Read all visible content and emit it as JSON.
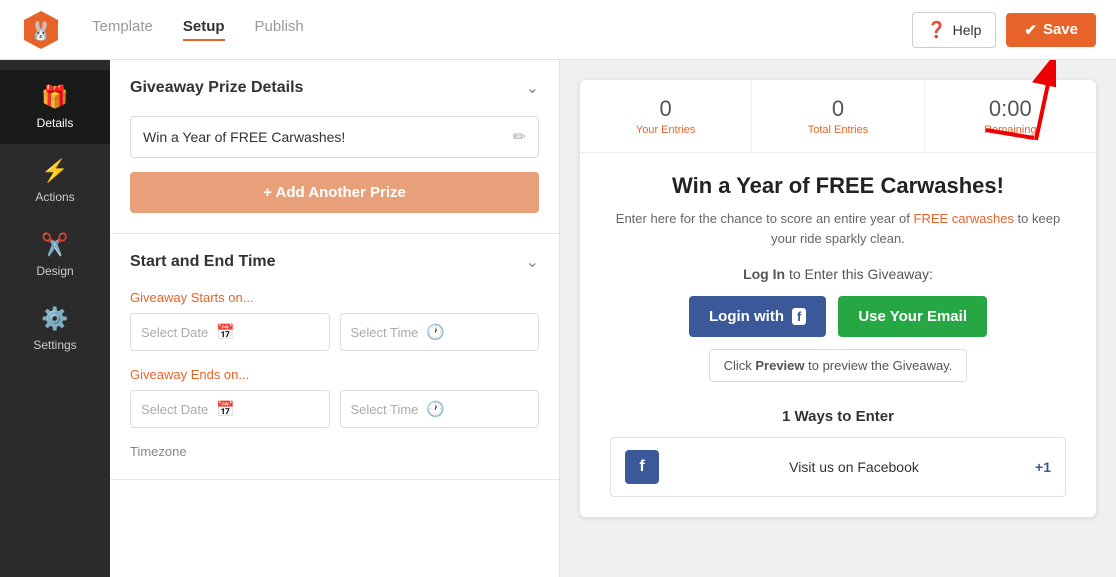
{
  "topNav": {
    "tabs": [
      {
        "label": "Template",
        "active": false
      },
      {
        "label": "Setup",
        "active": true
      },
      {
        "label": "Publish",
        "active": false
      }
    ],
    "helpLabel": "Help",
    "saveLabel": "Save"
  },
  "sidebar": {
    "items": [
      {
        "label": "Details",
        "icon": "gift",
        "active": true
      },
      {
        "label": "Actions",
        "icon": "lightning",
        "active": false
      },
      {
        "label": "Design",
        "icon": "design",
        "active": false
      },
      {
        "label": "Settings",
        "icon": "gear",
        "active": false
      }
    ]
  },
  "prizeSection": {
    "title": "Giveaway Prize Details",
    "prize": "Win a Year of FREE Carwashes!",
    "addPrizeLabel": "+ Add Another Prize"
  },
  "timeSection": {
    "title": "Start and End Time",
    "startsLabel": "Giveaway Starts on...",
    "endsLabel": "Giveaway Ends on...",
    "selectDate": "Select Date",
    "selectTime": "Select Time",
    "timezoneLabel": "Timezone"
  },
  "preview": {
    "stats": [
      {
        "value": "0",
        "label": "Your Entries"
      },
      {
        "value": "0",
        "label": "Total Entries"
      },
      {
        "value": "0:00",
        "label": "Remaining"
      }
    ],
    "title": "Win a Year of FREE Carwashes!",
    "description": "Enter here for the chance to score an entire year of FREE carwashes to keep your ride sparkly clean.",
    "loginLabel": "Log In to Enter this Giveaway:",
    "loginWithLabel": "Login with",
    "emailLabel": "Use Your Email",
    "previewHint": "Click Preview to preview the Giveaway.",
    "waysTitle": "1 Ways to Enter",
    "entryText": "Visit us on Facebook",
    "plusBadge": "+1"
  }
}
